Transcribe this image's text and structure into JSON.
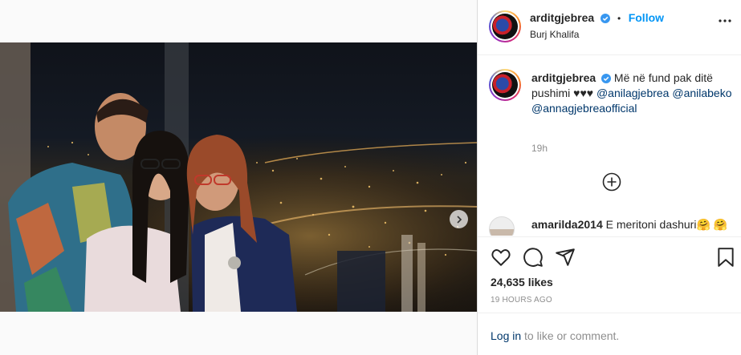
{
  "post": {
    "username": "arditgjebrea",
    "follow_label": "Follow",
    "separator": "•",
    "location": "Burj Khalifa",
    "caption_text": "Më në fund pak ditë pushimi ♥♥♥",
    "mentions": [
      "@anilagjebrea",
      "@anilabeko",
      "@annagjebreaofficial"
    ],
    "caption_time": "19h",
    "likes": "24,635 likes",
    "posted_ago": "19 HOURS AGO",
    "carousel": {
      "slides": 2,
      "active": 1
    }
  },
  "comments": [
    {
      "username": "amarilda2014",
      "text": "E meritoni dashuri🤗 🤗"
    }
  ],
  "footer": {
    "login_link": "Log in",
    "login_rest": " to like or comment."
  },
  "colors": {
    "accent": "#0095f6",
    "verified": "#3897f0",
    "link": "#00376b",
    "muted": "#8e8e8e"
  },
  "icons": [
    "tag-user-icon",
    "chevron-right-icon",
    "more-options-icon",
    "add-comment-icon",
    "heart-icon",
    "comment-icon",
    "share-icon",
    "bookmark-icon",
    "verified-icon"
  ]
}
